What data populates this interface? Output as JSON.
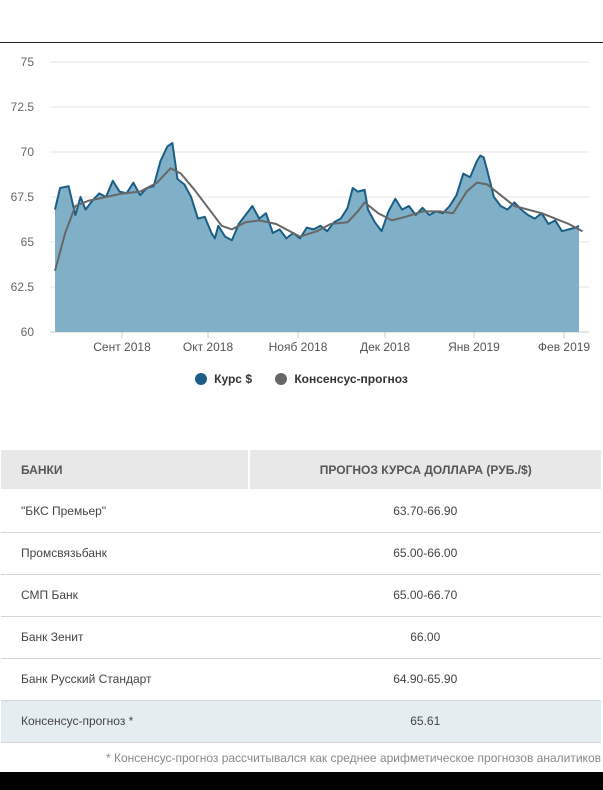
{
  "chart_data": {
    "type": "area",
    "ylim": [
      60,
      75
    ],
    "yticks": [
      "75",
      "72.5",
      "70",
      "67.5",
      "65",
      "62.5",
      "60"
    ],
    "xticks": [
      "Сент 2018",
      "Окт 2018",
      "Нояб 2018",
      "Дек 2018",
      "Янв 2019",
      "Фев 2019"
    ],
    "grid": true,
    "legend_position": "bottom",
    "series": [
      {
        "name": "Курс $",
        "type": "area",
        "color": "#1a5e85",
        "fill": "#7fb0c8",
        "points": [
          [
            0,
            66.8
          ],
          [
            1.5,
            68.0
          ],
          [
            4,
            68.1
          ],
          [
            6,
            66.5
          ],
          [
            7.5,
            67.5
          ],
          [
            9,
            66.8
          ],
          [
            11,
            67.3
          ],
          [
            13,
            67.7
          ],
          [
            15,
            67.5
          ],
          [
            17,
            68.4
          ],
          [
            19,
            67.8
          ],
          [
            21,
            67.7
          ],
          [
            23,
            68.3
          ],
          [
            25,
            67.6
          ],
          [
            27,
            68.0
          ],
          [
            29,
            68.1
          ],
          [
            31,
            69.5
          ],
          [
            33,
            70.3
          ],
          [
            34.5,
            70.5
          ],
          [
            36,
            68.5
          ],
          [
            38,
            68.2
          ],
          [
            40,
            67.5
          ],
          [
            42,
            66.3
          ],
          [
            44,
            66.4
          ],
          [
            46,
            65.5
          ],
          [
            47,
            65.2
          ],
          [
            48,
            65.9
          ],
          [
            50,
            65.3
          ],
          [
            52,
            65.1
          ],
          [
            54,
            66.0
          ],
          [
            56,
            66.5
          ],
          [
            58,
            67.0
          ],
          [
            60,
            66.3
          ],
          [
            62,
            66.6
          ],
          [
            64,
            65.5
          ],
          [
            66,
            65.7
          ],
          [
            68,
            65.2
          ],
          [
            70,
            65.5
          ],
          [
            72,
            65.2
          ],
          [
            74,
            65.8
          ],
          [
            76,
            65.7
          ],
          [
            78,
            65.9
          ],
          [
            80,
            65.6
          ],
          [
            82,
            66.1
          ],
          [
            84,
            66.3
          ],
          [
            86,
            66.9
          ],
          [
            87.5,
            68.0
          ],
          [
            89,
            67.8
          ],
          [
            91,
            67.9
          ],
          [
            92,
            66.8
          ],
          [
            94,
            66.1
          ],
          [
            96,
            65.6
          ],
          [
            98,
            66.7
          ],
          [
            100,
            67.4
          ],
          [
            102,
            66.8
          ],
          [
            104,
            67.0
          ],
          [
            106,
            66.5
          ],
          [
            108,
            66.9
          ],
          [
            110,
            66.5
          ],
          [
            112,
            66.7
          ],
          [
            114,
            66.6
          ],
          [
            116,
            67.0
          ],
          [
            118,
            67.6
          ],
          [
            120,
            68.8
          ],
          [
            122,
            68.6
          ],
          [
            124,
            69.5
          ],
          [
            125,
            69.8
          ],
          [
            126,
            69.7
          ],
          [
            127,
            69.0
          ],
          [
            129,
            67.5
          ],
          [
            131,
            67.0
          ],
          [
            133,
            66.8
          ],
          [
            135,
            67.2
          ],
          [
            137,
            66.8
          ],
          [
            139,
            66.5
          ],
          [
            141,
            66.3
          ],
          [
            143,
            66.6
          ],
          [
            145,
            66.0
          ],
          [
            147,
            66.2
          ],
          [
            149,
            65.6
          ],
          [
            151,
            65.7
          ],
          [
            153,
            65.8
          ],
          [
            154,
            65.9
          ]
        ]
      },
      {
        "name": "Консенсус-прогноз",
        "type": "line",
        "color": "#676767",
        "points": [
          [
            0,
            63.4
          ],
          [
            3,
            65.5
          ],
          [
            6,
            67.0
          ],
          [
            10,
            67.3
          ],
          [
            15,
            67.5
          ],
          [
            20,
            67.7
          ],
          [
            25,
            67.8
          ],
          [
            30,
            68.3
          ],
          [
            34,
            69.1
          ],
          [
            37,
            68.8
          ],
          [
            41,
            67.9
          ],
          [
            45,
            66.9
          ],
          [
            49,
            65.9
          ],
          [
            52,
            65.7
          ],
          [
            56,
            66.1
          ],
          [
            60,
            66.2
          ],
          [
            65,
            66.0
          ],
          [
            69,
            65.6
          ],
          [
            72,
            65.3
          ],
          [
            77,
            65.6
          ],
          [
            81,
            66.0
          ],
          [
            86,
            66.1
          ],
          [
            89,
            66.7
          ],
          [
            91,
            67.2
          ],
          [
            95,
            66.6
          ],
          [
            99,
            66.2
          ],
          [
            103,
            66.4
          ],
          [
            108,
            66.7
          ],
          [
            113,
            66.7
          ],
          [
            117,
            66.6
          ],
          [
            121,
            67.8
          ],
          [
            124,
            68.3
          ],
          [
            127,
            68.2
          ],
          [
            131,
            67.6
          ],
          [
            135,
            67.0
          ],
          [
            139,
            66.8
          ],
          [
            143,
            66.6
          ],
          [
            147,
            66.3
          ],
          [
            151,
            66.0
          ],
          [
            155,
            65.6
          ]
        ]
      }
    ]
  },
  "table": {
    "headers": [
      "БАНКИ",
      "ПРОГНОЗ КУРСА ДОЛЛАРА (РУБ./$)"
    ],
    "rows": [
      [
        "\"БКС Премьер\"",
        "63.70-66.90"
      ],
      [
        "Промсвязьбанк",
        "65.00-66.00"
      ],
      [
        "СМП Банк",
        "65.00-66.70"
      ],
      [
        "Банк Зенит",
        "66.00"
      ],
      [
        "Банк Русский Стандарт",
        "64.90-65.90"
      ],
      [
        "Консенсус-прогноз *",
        "65.61"
      ]
    ]
  },
  "footnote": "* Консенсус-прогноз рассчитывался как среднее арифметическое прогнозов аналитиков"
}
